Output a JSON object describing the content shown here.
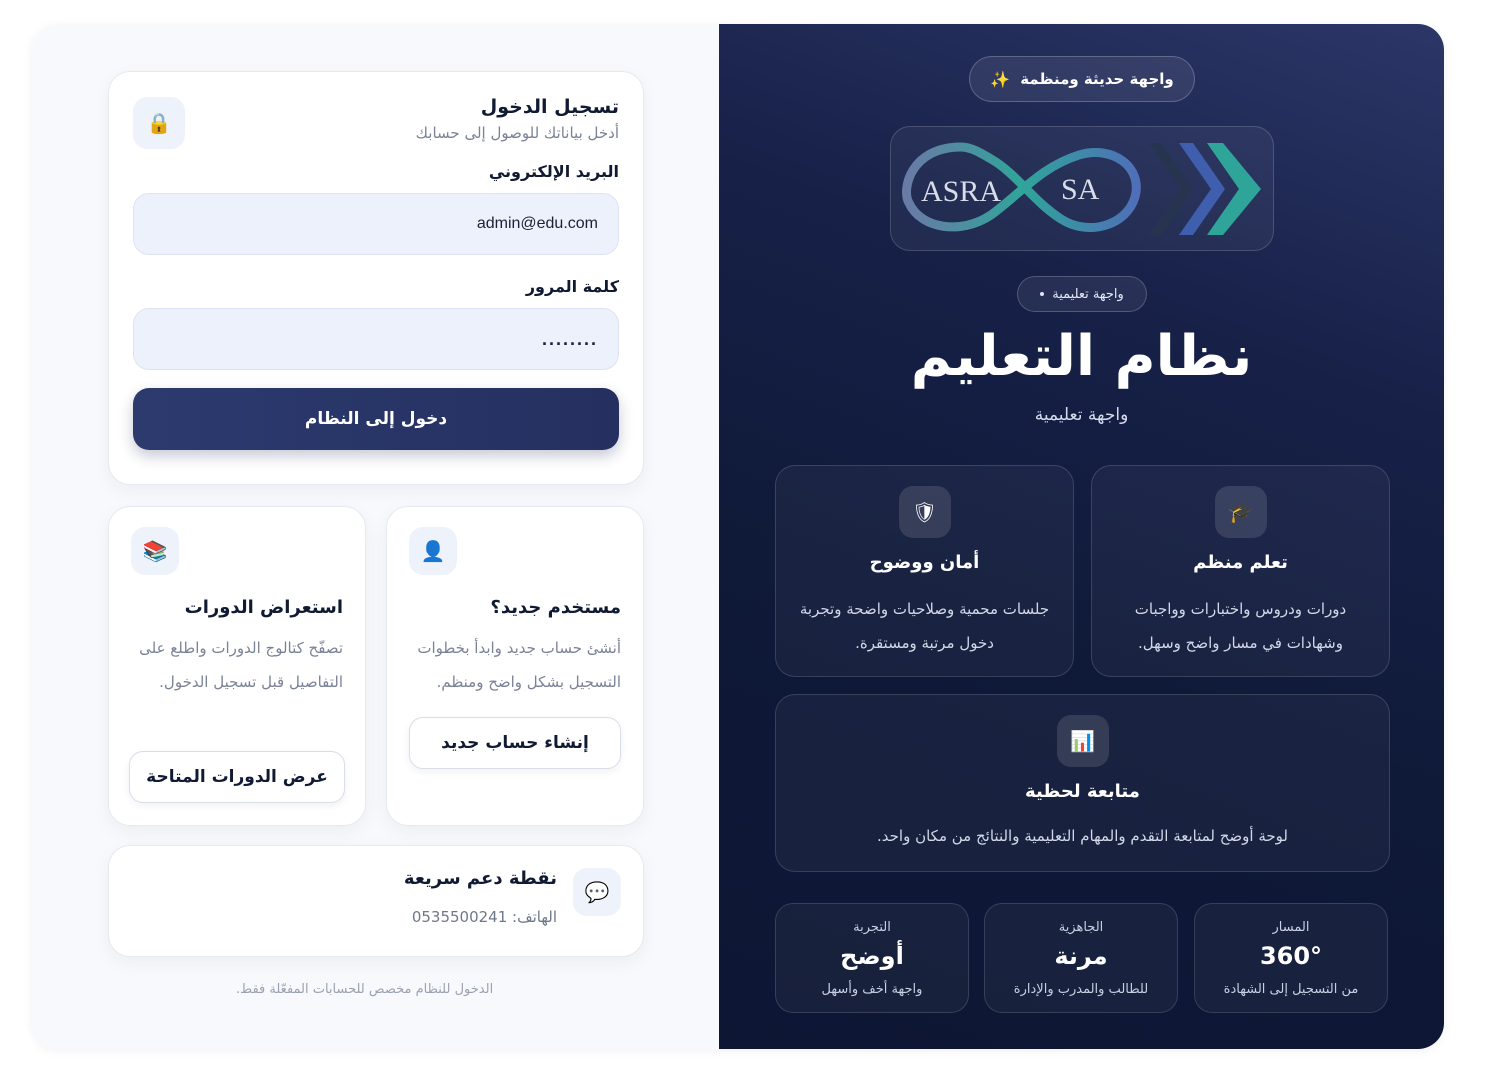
{
  "login": {
    "title": "تسجيل الدخول",
    "subtitle": "أدخل بياناتك للوصول إلى حسابك",
    "email_label": "البريد الإلكتروني",
    "email_value": "admin@edu.com",
    "password_label": "كلمة المرور",
    "password_value": "........",
    "submit_label": "دخول إلى النظام",
    "lock_icon": "🔒"
  },
  "new_user": {
    "title": "مستخدم جديد؟",
    "text": "أنشئ حساب جديد وابدأ بخطوات التسجيل بشكل واضح ومنظم.",
    "button": "إنشاء حساب جديد",
    "icon": "👤"
  },
  "browse": {
    "title": "استعراض الدورات",
    "text": "تصفّح كتالوج الدورات واطلع على التفاصيل قبل تسجيل الدخول.",
    "button": "عرض الدورات المتاحة",
    "icon": "📚"
  },
  "support": {
    "title": "نقطة دعم سريعة",
    "phone": "الهاتف: 0535500241",
    "icon": "💬"
  },
  "footer_note": "الدخول للنظام مخصص للحسابات المفعّلة فقط.",
  "hero": {
    "pill_top": "واجهة حديثة ومنظمة",
    "sparkle_icon": "✨",
    "logo_left": "ASRA",
    "logo_right": "SA",
    "pill_small": "واجهة تعليمية",
    "title": "نظام التعليم",
    "subtitle": "واجهة تعليمية"
  },
  "features": {
    "learn": {
      "icon": "🎓",
      "title": "تعلم منظم",
      "text": "دورات ودروس واختبارات وواجبات وشهادات في مسار واضح وسهل."
    },
    "safe": {
      "icon": "🛡",
      "title": "أمان ووضوح",
      "text": "جلسات محمية وصلاحيات واضحة وتجربة دخول مرتبة ومستقرة."
    },
    "track": {
      "icon": "📊",
      "title": "متابعة لحظية",
      "text": "لوحة أوضح لمتابعة التقدم والمهام التعليمية والنتائج من مكان واحد."
    }
  },
  "stats": {
    "path": {
      "label": "المسار",
      "value": "360°",
      "desc": "من التسجيل إلى الشهادة"
    },
    "ready": {
      "label": "الجاهزية",
      "value": "مرنة",
      "desc": "للطالب والمدرب والإدارة"
    },
    "exp": {
      "label": "التجربة",
      "value": "أوضح",
      "desc": "واجهة أخف وأسهل"
    }
  },
  "colors": {
    "primary": "#2c3a6e",
    "dark_panel": "#0f1938",
    "accent_teal": "#2fa59a"
  }
}
